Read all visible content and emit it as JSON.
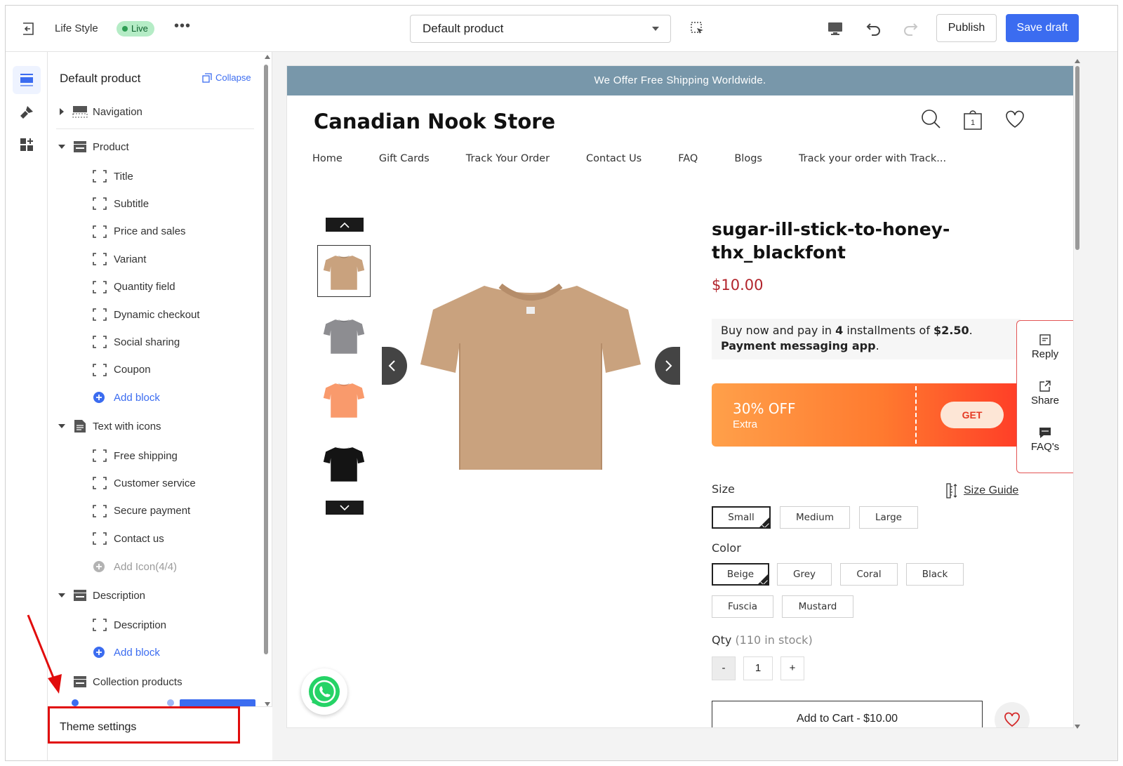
{
  "topbar": {
    "store_name": "Life Style",
    "status_badge": "Live",
    "template_select": "Default product",
    "publish_label": "Publish",
    "save_label": "Save draft"
  },
  "sidebar": {
    "title": "Default product",
    "collapse_label": "Collapse",
    "sections": {
      "navigation": "Navigation",
      "product": "Product",
      "product_blocks": [
        "Title",
        "Subtitle",
        "Price and sales",
        "Variant",
        "Quantity field",
        "Dynamic checkout",
        "Social sharing",
        "Coupon"
      ],
      "product_add": "Add block",
      "text_with_icons": "Text with icons",
      "icon_blocks": [
        "Free shipping",
        "Customer service",
        "Secure payment",
        "Contact us"
      ],
      "icon_add": "Add Icon(4/4)",
      "description": "Description",
      "description_blocks": [
        "Description"
      ],
      "description_add": "Add block",
      "collection_products": "Collection products"
    },
    "theme_settings": "Theme settings"
  },
  "preview": {
    "announcement": "We Offer Free Shipping Worldwide.",
    "store_name": "Canadian Nook Store",
    "cart_count": "1",
    "nav": [
      "Home",
      "Gift Cards",
      "Track Your Order",
      "Contact Us",
      "FAQ",
      "Blogs",
      "Track your order with Track..."
    ],
    "product_title": "sugar-ill-stick-to-honey-thx_blackfont",
    "price": "$10.00",
    "payment_message": {
      "pre": "Buy now and pay in ",
      "count": "4",
      "mid": " installments of ",
      "amount": "$2.50",
      "post": ".",
      "app": "Payment messaging app",
      "app_post": "."
    },
    "coupon": {
      "off": "30% OFF",
      "extra": "Extra",
      "cta": "GET"
    },
    "float_panel": [
      "Reply",
      "Share",
      "FAQ's"
    ],
    "size_label": "Size",
    "size_guide": "Size Guide",
    "sizes": [
      "Small",
      "Medium",
      "Large"
    ],
    "selected_size": "Small",
    "color_label": "Color",
    "colors": [
      "Beige",
      "Grey",
      "Coral",
      "Black",
      "Fuscia",
      "Mustard"
    ],
    "selected_color": "Beige",
    "qty_label": "Qty",
    "stock_note": "(110 in stock)",
    "qty_minus": "-",
    "qty_value": "1",
    "qty_plus": "+",
    "add_to_cart": "Add to Cart - $10.00",
    "colors_hex": {
      "accent": "#3b6cf0",
      "live": "#b5ecc6",
      "announce": "#7897aa",
      "price": "#b2242c",
      "annotation": "#e10c0c"
    },
    "shirt_colors": [
      "#c9a27e",
      "#8d8d91",
      "#f99a6c",
      "#141414"
    ]
  }
}
